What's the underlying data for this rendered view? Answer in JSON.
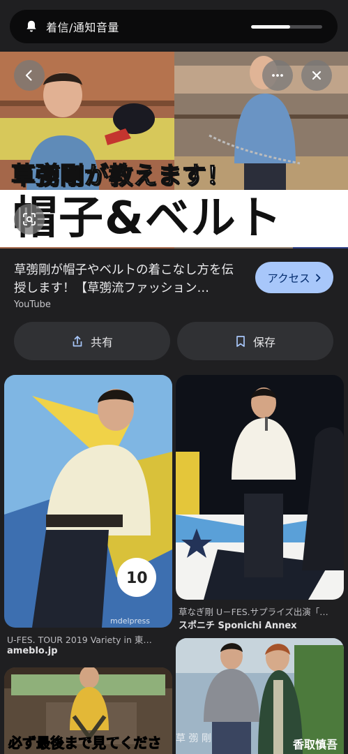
{
  "volume": {
    "label": "着信/通知音量",
    "level": 0.55
  },
  "hero": {
    "banner_line1": "草彅剛が教えます！",
    "banner_line2": "帽子&ベルト"
  },
  "result": {
    "title": "草彅剛が帽子やベルトの着こなし方を伝授します！【草彅流ファッション…",
    "source": "YouTube",
    "access_label": "アクセス"
  },
  "actions": {
    "share_label": "共有",
    "save_label": "保存"
  },
  "grid": {
    "cards": [
      {
        "caption": "U-FES. TOUR 2019 Variety in 東…",
        "source": "ameblo.jp",
        "watermark": "mdelpress"
      },
      {
        "caption": "草なぎ剛 U－FES.サプライズ出演「…",
        "source": "スポニチ Sponichi Annex"
      },
      {
        "overlay_text": "必ず最後まで見てください"
      },
      {
        "overlay_text_a": "草 彅 剛",
        "overlay_text_b": "香取慎吾"
      }
    ]
  },
  "colors": {
    "background": "#1f1f21",
    "accent": "#a8c7fa",
    "button": "#303134"
  }
}
